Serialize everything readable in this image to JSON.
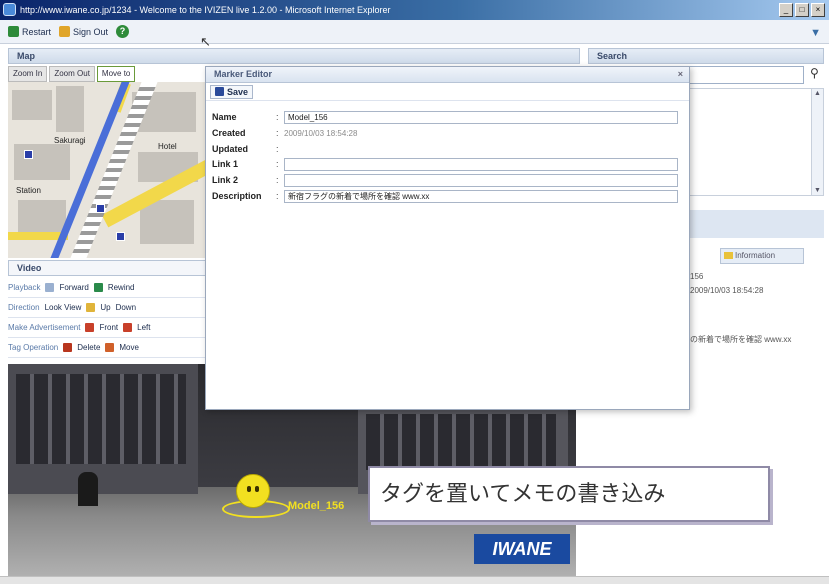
{
  "window": {
    "title": "http://www.iwane.co.jp/1234 - Welcome to the IVIZEN live 1.2.00 - Microsoft Internet Explorer",
    "controls": [
      "_",
      "□",
      "×"
    ]
  },
  "toolbar": {
    "restart_label": "Restart",
    "signout_label": "Sign Out"
  },
  "map": {
    "panel_title": "Map",
    "tabs": [
      "Zoom In",
      "Zoom Out",
      "Move to"
    ],
    "labels": [
      "Sakuragi",
      "Hotel",
      "Station"
    ]
  },
  "search": {
    "panel_title": "Search",
    "placeholder": ""
  },
  "video": {
    "panel_title": "Video",
    "rows": [
      {
        "label": "Playback",
        "actions": [
          "Forward",
          "Rewind"
        ]
      },
      {
        "label": "Direction",
        "actions": [
          "Look View",
          "Up",
          "Down"
        ]
      },
      {
        "label": "Make Advertisement",
        "actions": [
          "Front",
          "Left"
        ]
      },
      {
        "label": "Tag Operation",
        "actions": [
          "Delete",
          "Move"
        ]
      }
    ]
  },
  "street_view": {
    "tag_label": "Model_156",
    "caption": "タグを置いてメモの書き込み",
    "logo_text": "IWANE"
  },
  "right_panel": {
    "subtab_label": "Information",
    "peek_lines": [
      "156",
      "2009/10/03 18:54:28",
      "の新着で場所を確認 www.xx"
    ]
  },
  "marker_editor": {
    "title": "Marker Editor",
    "save_label": "Save",
    "fields": {
      "name": {
        "label": "Name",
        "value": "Model_156"
      },
      "created": {
        "label": "Created",
        "value": "2009/10/03 18:54:28"
      },
      "updated": {
        "label": "Updated",
        "value": ""
      },
      "link1": {
        "label": "Link 1",
        "value": ""
      },
      "link2": {
        "label": "Link 2",
        "value": ""
      },
      "description": {
        "label": "Description",
        "value": "新宿フラグの新着で場所を確認  www.xx"
      }
    }
  },
  "colors": {
    "title_bar": "#0a246a",
    "caption_border": "#8f8aa6",
    "tag_yellow": "#f2e020",
    "logo_blue": "#1a4aa0",
    "route_blue": "#4a6ed8"
  }
}
